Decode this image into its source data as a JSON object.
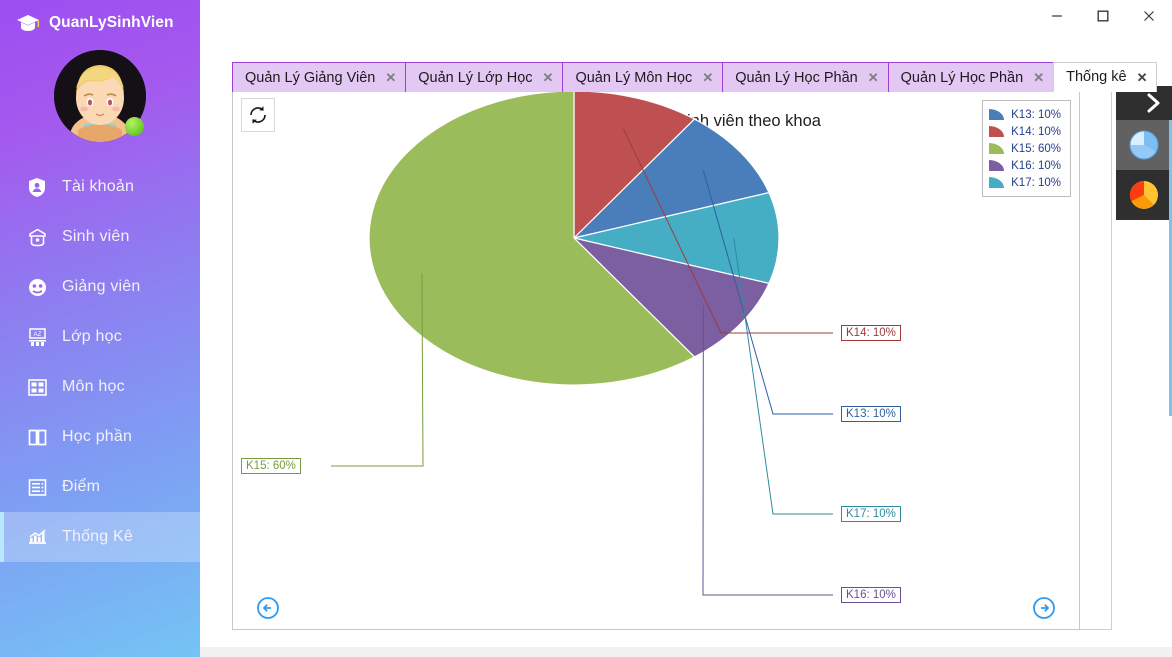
{
  "app": {
    "brand": "QuanLySinhVien",
    "brand_icon": "graduation-cap-icon",
    "avatar_status": "online"
  },
  "window_controls": {
    "minimize": "—",
    "maximize": "☐",
    "close": "✕"
  },
  "sidebar": {
    "items": [
      {
        "label": "Tài khoản",
        "icon": "shield-user-icon",
        "active": false
      },
      {
        "label": "Sinh viên",
        "icon": "student-icon",
        "active": false
      },
      {
        "label": "Giảng viên",
        "icon": "teacher-icon",
        "active": false
      },
      {
        "label": "Lớp học",
        "icon": "classroom-icon",
        "active": false
      },
      {
        "label": "Môn học",
        "icon": "subject-icon",
        "active": false
      },
      {
        "label": "Học phần",
        "icon": "book-icon",
        "active": false
      },
      {
        "label": "Điểm",
        "icon": "grades-list-icon",
        "active": false
      },
      {
        "label": "Thống Kê",
        "icon": "bar-chart-icon",
        "active": true
      }
    ]
  },
  "tabs": {
    "items": [
      {
        "label": "Quản Lý Giảng Viên",
        "close": "✕",
        "active": false
      },
      {
        "label": "Quản Lý Lớp Học",
        "close": "✕",
        "active": false
      },
      {
        "label": "Quản Lý Môn Học",
        "close": "✕",
        "active": false
      },
      {
        "label": "Quản Lý Học Phần",
        "close": "✕",
        "active": false
      },
      {
        "label": "Quản Lý Học Phần",
        "close": "✕",
        "active": false
      },
      {
        "label": "Thống kê",
        "close": "✕",
        "active": true
      }
    ],
    "nav_prev": "◀",
    "nav_next": "▶"
  },
  "chart_toolbar": {
    "refresh_icon": "refresh-icon",
    "prev_icon": "arrow-left-circle-icon",
    "next_icon": "arrow-right-circle-icon"
  },
  "right_dock": {
    "toggle_icon": "chevron-right-icon",
    "items": [
      {
        "icon": "pie-chart-blue-icon",
        "selected": true
      },
      {
        "icon": "pie-chart-orange-icon",
        "selected": false
      }
    ]
  },
  "chart_data": {
    "type": "pie",
    "title": "Sơ đồ thống kê số lượng sinh viên theo khoa",
    "xlabel": "",
    "ylabel": "",
    "legend_position": "top-right",
    "grid": false,
    "categories": [
      "K13",
      "K14",
      "K15",
      "K16",
      "K17"
    ],
    "values": [
      10,
      60,
      10,
      10,
      10
    ],
    "unit": "%",
    "slices": [
      {
        "name": "K13",
        "value": 10,
        "label": "K13: 10%",
        "color": "#4a7ebb",
        "legend": "K13: 10%"
      },
      {
        "name": "K14",
        "value": 10,
        "label": "K14: 10%",
        "color": "#bf5052",
        "legend": "K14: 10%"
      },
      {
        "name": "K15",
        "value": 60,
        "label": "K15: 60%",
        "color": "#9bbc5a",
        "legend": "K15: 60%"
      },
      {
        "name": "K16",
        "value": 10,
        "label": "K16: 10%",
        "color": "#7c5fa0",
        "legend": "K16: 10%"
      },
      {
        "name": "K17",
        "value": 10,
        "label": "K17: 10%",
        "color": "#45aec4",
        "legend": "K17: 10%"
      }
    ],
    "callouts": [
      {
        "name": "K14",
        "text": "K14: 10%",
        "color": "#9e3b3d"
      },
      {
        "name": "K13",
        "text": "K13: 10%",
        "color": "#2f5f9e"
      },
      {
        "name": "K17",
        "text": "K17: 10%",
        "color": "#2f8aa0"
      },
      {
        "name": "K16",
        "text": "K16: 10%",
        "color": "#6b4f94"
      },
      {
        "name": "K15",
        "text": "K15: 60%",
        "color": "#7a9b42"
      }
    ]
  },
  "colors": {
    "brand_purple": "#9b4ff0",
    "brand_blue": "#74c4f4",
    "tab_purple": "#e3c8f3",
    "tab_border": "#9b3fd6",
    "accent_blue": "#2e9bf0",
    "dock_dark": "#2f2f2f"
  }
}
